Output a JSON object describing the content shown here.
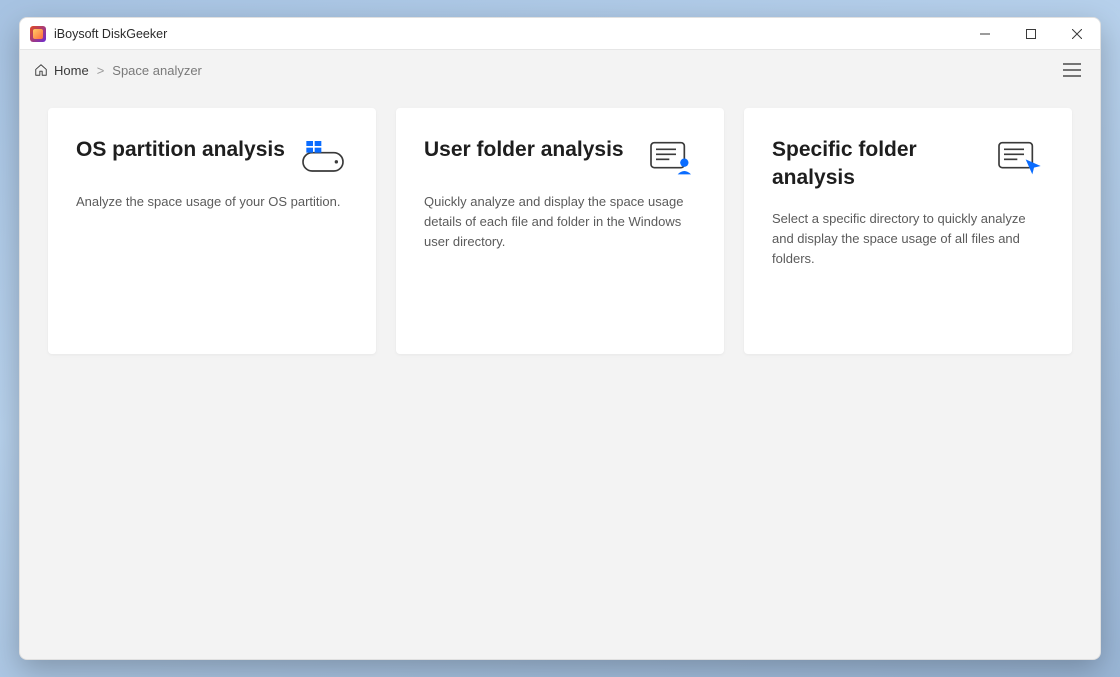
{
  "window": {
    "app_title": "iBoysoft DiskGeeker"
  },
  "breadcrumb": {
    "home_label": "Home",
    "current_label": "Space analyzer"
  },
  "cards": [
    {
      "title": "OS partition analysis",
      "description": "Analyze the space usage of your OS partition.",
      "icon": "drive-windows-icon"
    },
    {
      "title": "User folder analysis",
      "description": "Quickly analyze and display the space usage details of each file and folder in the Windows user directory.",
      "icon": "folder-user-icon"
    },
    {
      "title": "Specific folder analysis",
      "description": "Select a specific directory to quickly analyze and display the space usage of all files and folders.",
      "icon": "folder-cursor-icon"
    }
  ],
  "colors": {
    "accent": "#0a6cff"
  }
}
